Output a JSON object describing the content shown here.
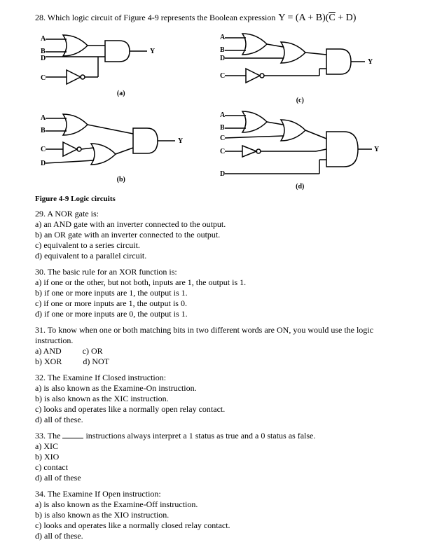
{
  "q28": {
    "text_a": "28. Which logic circuit of Figure 4-9 represents the Boolean expression",
    "expr_lhs": "Y = (A + B)(",
    "expr_cbar": "C",
    "expr_tail": " + D)"
  },
  "figure": {
    "a_label": "(a)",
    "b_label": "(b)",
    "c_label": "(c)",
    "d_label": "(d)",
    "caption": "Figure 4-9  Logic circuits",
    "pins": {
      "A": "A",
      "B": "B",
      "C": "C",
      "D": "D",
      "Y": "Y"
    }
  },
  "q29": {
    "stem": "29. A NOR gate is:",
    "a": "a) an AND gate with an inverter connected to the output.",
    "b": "b) an OR gate with an inverter connected to the output.",
    "c": "c) equivalent to a series circuit.",
    "d": "d) equivalent to a parallel circuit."
  },
  "q30": {
    "stem": "30. The basic rule for an XOR function is:",
    "a": "a) if one or the other, but not both, inputs are 1, the output is 1.",
    "b": "b) if one or more inputs are 1, the output is 1.",
    "c": "c) if one or more inputs are 1, the output is 0.",
    "d": "d) if one or more inputs are 0, the output is 1."
  },
  "q31": {
    "stem": "31. To know when one or both matching bits in two different words are ON, you would use the logic instruction.",
    "a": "a) AND",
    "b": "b) XOR",
    "c": "c) OR",
    "d": "d) NOT"
  },
  "q32": {
    "stem": "32. The Examine If Closed instruction:",
    "a": "a) is also known as the Examine-On instruction.",
    "b": "b) is also known as the XIC instruction.",
    "c": "c) looks and operates like a normally open relay contact.",
    "d": "d) all of these."
  },
  "q33": {
    "stem_a": "33. The ",
    "stem_b": " instructions always interpret a 1 status as true and a 0 status as false.",
    "a": "a) XIC",
    "b": "b) XIO",
    "c": "c) contact",
    "d": "d) all of these"
  },
  "q34": {
    "stem": "34. The Examine If Open instruction:",
    "a": "a) is also known as the Examine-Off instruction.",
    "b": "b) is also known as the XIO instruction.",
    "c": "c) looks and operates like a normally closed relay contact.",
    "d": "d) all of these."
  }
}
